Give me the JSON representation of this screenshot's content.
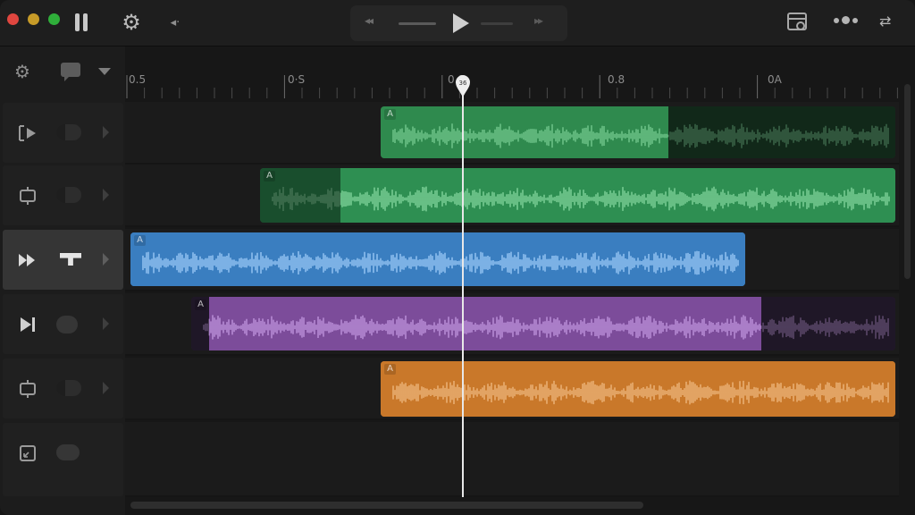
{
  "window": {
    "controls": [
      "close",
      "minimize",
      "zoom"
    ]
  },
  "toolbar": {
    "left_icons": [
      "pause-icon",
      "gear-icon",
      "rewind-icon"
    ],
    "transport": [
      "skip-back-icon",
      "play-icon",
      "skip-forward-icon"
    ],
    "right_icons": [
      "browser-icon",
      "dots-icon",
      "swap-icon"
    ]
  },
  "track_header_bar": {
    "icons": [
      "gear-icon",
      "comment-icon",
      "chevron-down-icon"
    ]
  },
  "ruler": {
    "labels": [
      "0.5",
      "0·S",
      "0.8",
      "0.8",
      "0A"
    ]
  },
  "playhead": {
    "label": "36"
  },
  "tracks": [
    {
      "icon": "play-track-icon",
      "clip_label": "A",
      "color": "#2f8a4e",
      "selected": false
    },
    {
      "icon": "loop-track-icon",
      "clip_label": "A",
      "color": "#2e8f52",
      "selected": false
    },
    {
      "icon": "fast-forward-icon",
      "clip_label": "A",
      "color": "#3a7ec0",
      "selected": true
    },
    {
      "icon": "skip-end-icon",
      "clip_label": "A",
      "color": "#7c4c9a",
      "selected": false
    },
    {
      "icon": "loop-track-icon",
      "clip_label": "A",
      "color": "#c9782a",
      "selected": false
    },
    {
      "icon": "resize-icon",
      "clip_label": "",
      "color": "",
      "selected": false
    }
  ]
}
